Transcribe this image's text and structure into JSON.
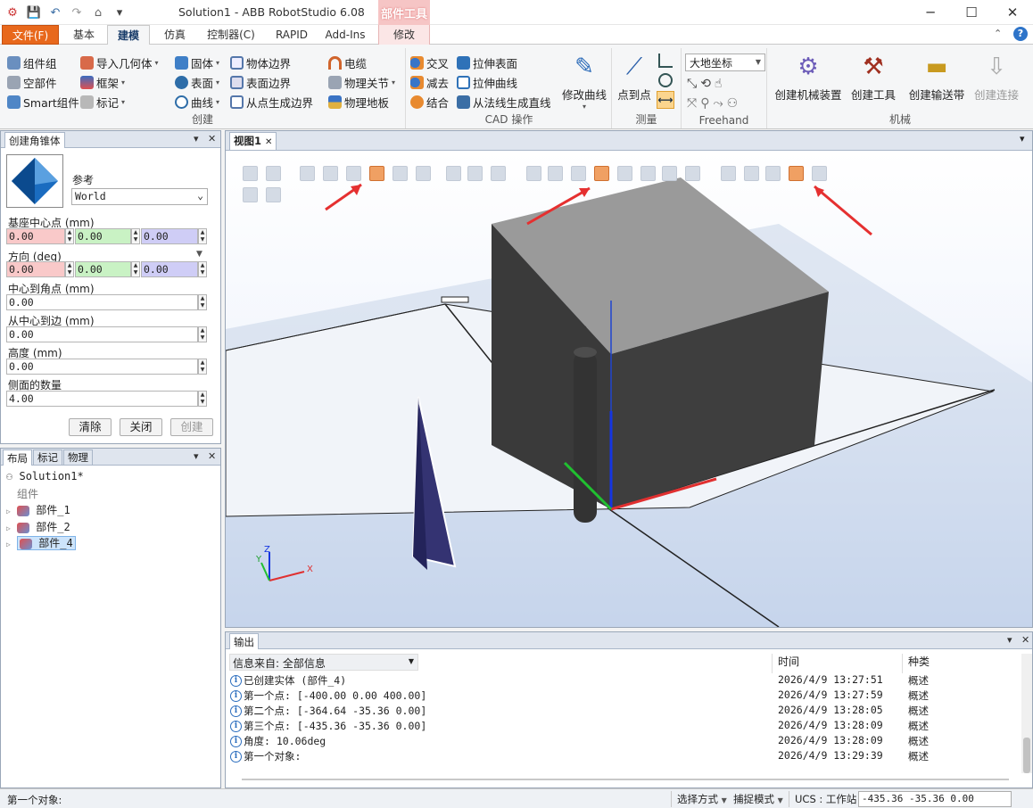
{
  "window": {
    "title": "Solution1 - ABB RobotStudio 6.08",
    "context_group": "部件工具"
  },
  "tabs": [
    "文件(F)",
    "基本",
    "建模",
    "仿真",
    "控制器(C)",
    "RAPID",
    "Add-Ins",
    "修改"
  ],
  "ribbon": {
    "groups": {
      "create": {
        "label": "创建",
        "items": [
          "组件组",
          "空部件",
          "Smart组件",
          "导入几何体",
          "框架",
          "标记",
          "固体",
          "表面",
          "曲线",
          "物体边界",
          "表面边界",
          "从点生成边界",
          "电缆",
          "物理关节",
          "物理地板"
        ]
      },
      "cad": {
        "label": "CAD 操作",
        "items": [
          "交叉",
          "减去",
          "结合",
          "拉伸表面",
          "拉伸曲线",
          "从法线生成直线",
          "修改曲线"
        ]
      },
      "measure": {
        "label": "测量",
        "items": [
          "点到点"
        ]
      },
      "freehand": {
        "label": "Freehand",
        "coord": "大地坐标"
      },
      "mechanism": {
        "label": "机械",
        "items": [
          "创建机械装置",
          "创建工具",
          "创建输送带",
          "创建连接"
        ]
      }
    }
  },
  "create_panel": {
    "title": "创建角锥体",
    "reference_label": "参考",
    "reference_value": "World",
    "base_center_label": "基座中心点 (mm)",
    "base_center": [
      "0.00",
      "0.00",
      "0.00"
    ],
    "direction_label": "方向 (deg)",
    "direction": [
      "0.00",
      "0.00",
      "0.00"
    ],
    "center_to_corner_label": "中心到角点 (mm)",
    "center_to_corner": "0.00",
    "center_to_edge_label": "从中心到边 (mm)",
    "center_to_edge": "0.00",
    "height_label": "高度 (mm)",
    "height": "0.00",
    "sides_label": "侧面的数量",
    "sides": "4.00",
    "buttons": [
      "清除",
      "关闭",
      "创建"
    ]
  },
  "layout_panel": {
    "tabs": [
      "布局",
      "标记",
      "物理"
    ],
    "root": "Solution1*",
    "group": "组件",
    "parts": [
      "部件_1",
      "部件_2",
      "部件_4"
    ]
  },
  "viewport": {
    "tab": "视图1",
    "axes": [
      "Z",
      "Y",
      "X"
    ]
  },
  "output": {
    "title": "输出",
    "filter_label": "信息来自: 全部信息",
    "headers": [
      "时间",
      "种类"
    ],
    "rows": [
      {
        "msg": "已创建实体 (部件_4)",
        "time": "2026/4/9 13:27:51",
        "kind": "概述"
      },
      {
        "msg": "第一个点: [-400.00 0.00 400.00]",
        "time": "2026/4/9 13:27:59",
        "kind": "概述"
      },
      {
        "msg": "第二个点: [-364.64 -35.36 0.00]",
        "time": "2026/4/9 13:28:05",
        "kind": "概述"
      },
      {
        "msg": "第三个点: [-435.36 -35.36 0.00]",
        "time": "2026/4/9 13:28:09",
        "kind": "概述"
      },
      {
        "msg": "角度: 10.06deg",
        "time": "2026/4/9 13:28:09",
        "kind": "概述"
      },
      {
        "msg": "第一个对象:",
        "time": "2026/4/9 13:29:39",
        "kind": "概述"
      }
    ]
  },
  "status": {
    "message": "第一个对象:",
    "select_mode": "选择方式",
    "snap_mode": "捕捉模式",
    "ucs": "UCS : 工作站",
    "coords": "-435.36  -35.36  0.00"
  }
}
